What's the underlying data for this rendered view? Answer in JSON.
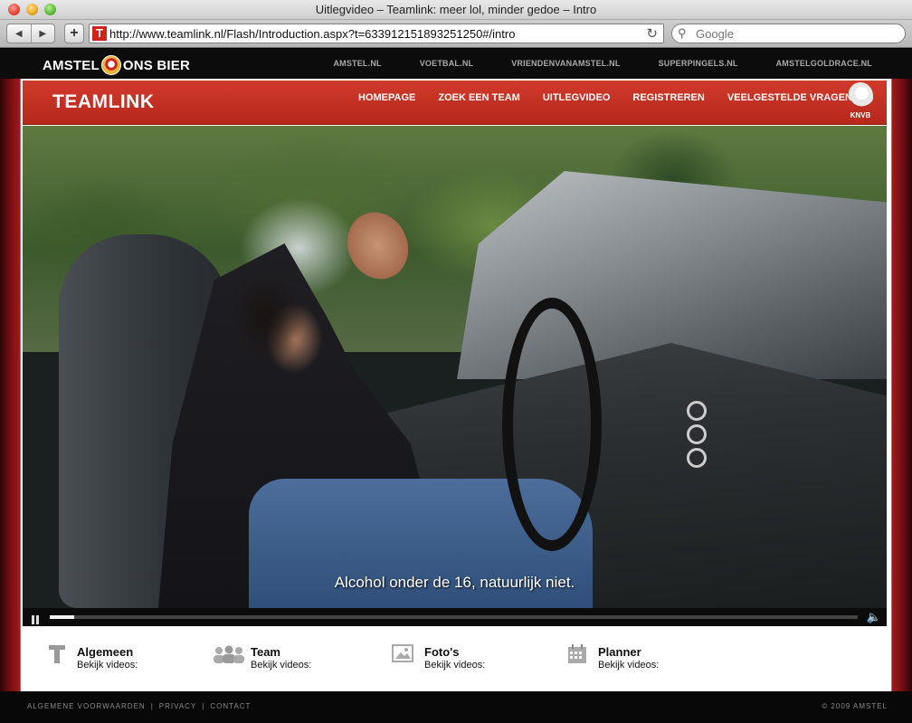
{
  "browser": {
    "window_title": "Uitlegvideo – Teamlink: meer lol, minder gedoe – Intro",
    "url": "http://www.teamlink.nl/Flash/Introduction.aspx?t=633912151893251250#/intro",
    "search_placeholder": "Google",
    "favicon_letter": "T",
    "add_label": "+"
  },
  "amstel_bar": {
    "logo_left": "AMSTEL",
    "logo_right": "ONS BIER",
    "links": [
      "AMSTEL.NL",
      "VOETBAL.NL",
      "VRIENDENVANAMSTEL.NL",
      "SUPERPINGELS.NL",
      "AMSTELGOLDRACE.NL"
    ]
  },
  "site": {
    "logo": "TEAMLINK",
    "nav": [
      "HOMEPAGE",
      "ZOEK EEN TEAM",
      "UITLEGVIDEO",
      "REGISTREREN",
      "VEELGESTELDE VRAGEN"
    ],
    "partner": "KNVB"
  },
  "video": {
    "subtitle": "Alcohol onder de 16, natuurlijk niet.",
    "progress": 0.03
  },
  "categories": [
    {
      "name": "Algemeen",
      "sub": "Bekijk videos:",
      "icon": "letter-t-icon"
    },
    {
      "name": "Team",
      "sub": "Bekijk videos:",
      "icon": "team-people-icon"
    },
    {
      "name": "Foto's",
      "sub": "Bekijk videos:",
      "icon": "photo-icon"
    },
    {
      "name": "Planner",
      "sub": "Bekijk videos:",
      "icon": "calendar-icon"
    }
  ],
  "footer": {
    "links": [
      "ALGEMENE VOORWAARDEN",
      "PRIVACY",
      "CONTACT"
    ],
    "copyright": "© 2009 AMSTEL"
  }
}
